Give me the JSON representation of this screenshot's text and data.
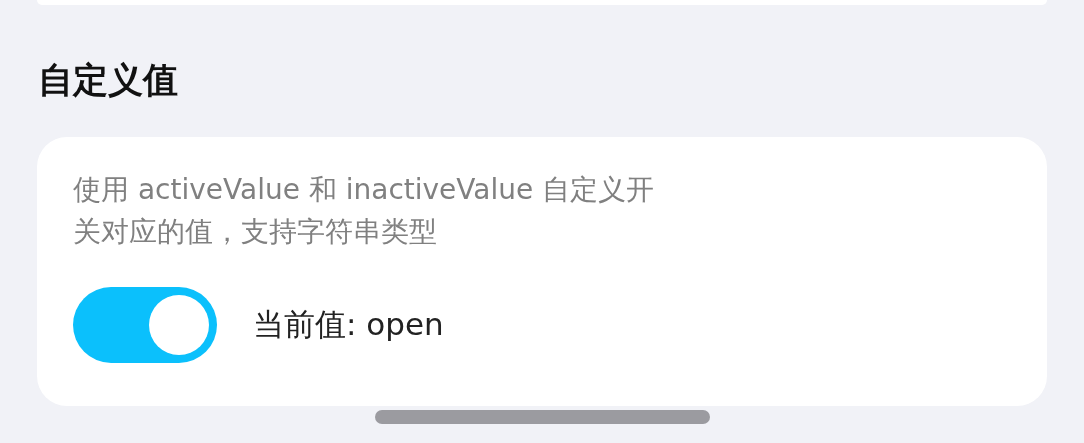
{
  "section": {
    "title": "自定义值"
  },
  "card": {
    "description": "使用 activeValue 和 inactiveValue 自定义开关对应的值，支持字符串类型",
    "switch": {
      "on": true
    },
    "value_label": "当前值: open"
  }
}
